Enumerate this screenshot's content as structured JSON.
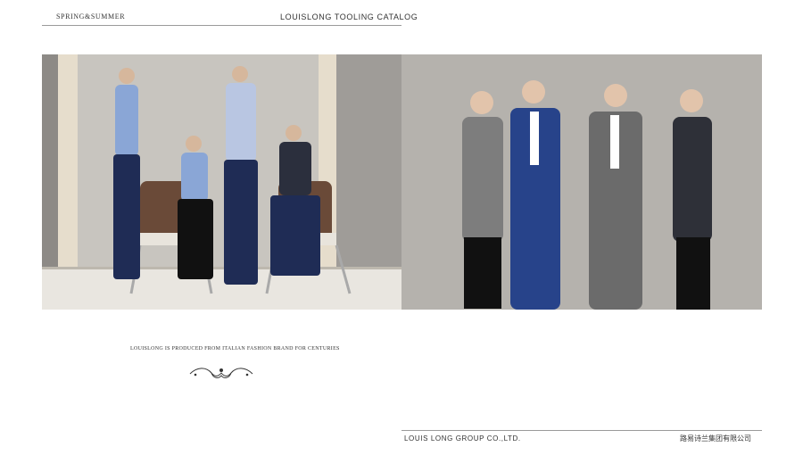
{
  "header": {
    "season": "SPRING&SUMMER",
    "catalog_title": "LOUISLONG TOOLING CATALOG"
  },
  "tagline": "Louislong is produced from italian fashion brand for centuries",
  "footer": {
    "company_en": "LOUIS LONG GROUP CO.,LTD.",
    "company_cn": "路易诗兰集团有限公司"
  },
  "colors": {
    "rule": "#9a9a9a",
    "shirt_blue": "#8aa6d6",
    "suit_navy": "#1f2c55",
    "suit_royal": "#27438a",
    "suit_grey": "#7d7d7d"
  }
}
